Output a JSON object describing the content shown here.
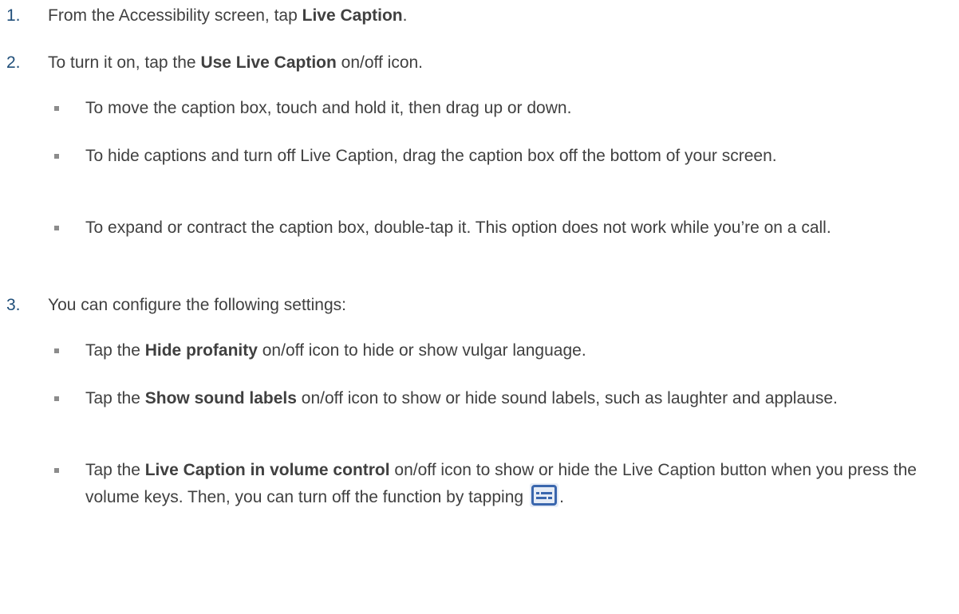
{
  "steps": [
    {
      "number": "1.",
      "prefix": "From the Accessibility screen, tap ",
      "bold": "Live Caption",
      "suffix": "."
    },
    {
      "number": "2.",
      "prefix": "To turn it on, tap the ",
      "bold": "Use Live Caption",
      "suffix": " on/off icon.",
      "bullets": [
        "To move the caption box, touch and hold it, then drag up or down.",
        "To hide captions and turn off Live Caption, drag the caption box off the bottom of your screen.",
        "To expand or contract the caption box, double-tap it. This option does not work while you’re on a call."
      ]
    },
    {
      "number": "3.",
      "text": "You can configure the following settings:",
      "bullets": [
        {
          "prefix": "Tap the ",
          "bold": "Hide profanity",
          "suffix": " on/off icon to hide or show vulgar language."
        },
        {
          "prefix": "Tap the ",
          "bold": "Show sound labels",
          "suffix": " on/off icon to show or hide sound labels, such as laughter and applause."
        },
        {
          "prefix": "Tap the ",
          "bold": "Live Caption in volume control",
          "suffix": " on/off icon to show or hide the Live Caption button when you press the volume keys. Then, you can turn off the function by tapping",
          "icon": "live-caption-icon",
          "end": "."
        }
      ]
    }
  ],
  "colors": {
    "text": "#404040",
    "number": "#1f4e79",
    "bullet": "#8c8c8c",
    "icon": "#3a66ad"
  }
}
